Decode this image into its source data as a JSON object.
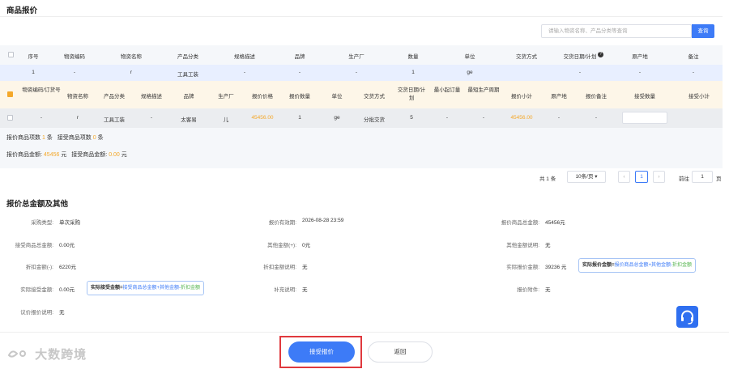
{
  "section1_title": "商品报价",
  "search": {
    "placeholder": "请输入物资名称、产品分类等查询",
    "button": "查询"
  },
  "table1": {
    "headers": [
      "序号",
      "物资编码",
      "物资名称",
      "产品分类",
      "规格描述",
      "品牌",
      "生产厂",
      "数量",
      "单位",
      "交货方式",
      "交货日期/计划",
      "原产地",
      "备注"
    ],
    "row": [
      "1",
      "-",
      "r",
      "工具工装",
      "-",
      "-",
      "-",
      "1",
      "ge",
      "",
      "-",
      "-",
      "-"
    ]
  },
  "table2": {
    "headers": [
      "物资编码/订货号",
      "物资名称",
      "产品分类",
      "规格描述",
      "品牌",
      "生产厂",
      "报价价格",
      "报价数量",
      "单位",
      "交货方式",
      "交货日期/计划",
      "最小起订量",
      "最短生产周期",
      "报价小计",
      "原产地",
      "报价备注",
      "接受数量",
      "接受小计"
    ],
    "row": [
      "-",
      "r",
      "工具工装",
      "-",
      "太客易",
      "儿",
      "45456.00",
      "1",
      "ge",
      "分批交货",
      "5",
      "-",
      "-",
      "45456.00",
      "-",
      "-",
      "",
      ""
    ]
  },
  "summary": {
    "items_label": "报价商品项数",
    "items_count": "1",
    "items_unit": "条",
    "accepted_label": "接受商品项数",
    "accepted_count": "0",
    "accepted_unit": "条",
    "amount_label": "报价商品金额:",
    "amount": "45456",
    "amount_unit": "元",
    "accepted_amount_label": "接受商品金额:",
    "accepted_amount": "0.00",
    "accepted_amount_unit": "元"
  },
  "pager": {
    "total": "共 1 条",
    "per_page": "10条/页",
    "prev": "‹",
    "page": "1",
    "next": "›",
    "goto": "前往",
    "goto_page": "1",
    "page_unit": "页"
  },
  "section2_title": "报价总金额及其他",
  "details": {
    "purchase_type_label": "采购类型:",
    "purchase_type": "单次采购",
    "validity_label": "报价有效期:",
    "validity": "2026-08-28 23:59",
    "total_label": "报价商品总金额:",
    "total": "45456元",
    "accepted_total_label": "接受商品总金额:",
    "accepted_total": "0.00元",
    "other_label": "其他金额(+):",
    "other": "0元",
    "other_note_label": "其他金额说明:",
    "other_note": "无",
    "discount_label": "折扣金额(-):",
    "discount": "6220元",
    "discount_note_label": "折扣金额说明:",
    "discount_note": "无",
    "actual_label": "实际报价金额:",
    "actual": "39236 元",
    "actual_tip_bold": "实际报价金额=",
    "actual_tip_blue": "报价商品总金额+其他金额-",
    "actual_tip_green": "折扣金额",
    "actual_accept_label": "实际接受金额:",
    "actual_accept": "0.00元",
    "accept_tip_bold": "实际接受金额=",
    "accept_tip_blue": "接受商品总金额+其他金额-",
    "accept_tip_green": "折扣金额",
    "supplement_label": "补充说明:",
    "supplement": "无",
    "attachment_label": "报价附件:",
    "attachment": "无",
    "bargain_label": "议价报价说明:",
    "bargain": "无"
  },
  "footer": {
    "accept": "接受报价",
    "back": "返回",
    "logo": "大数跨境"
  }
}
